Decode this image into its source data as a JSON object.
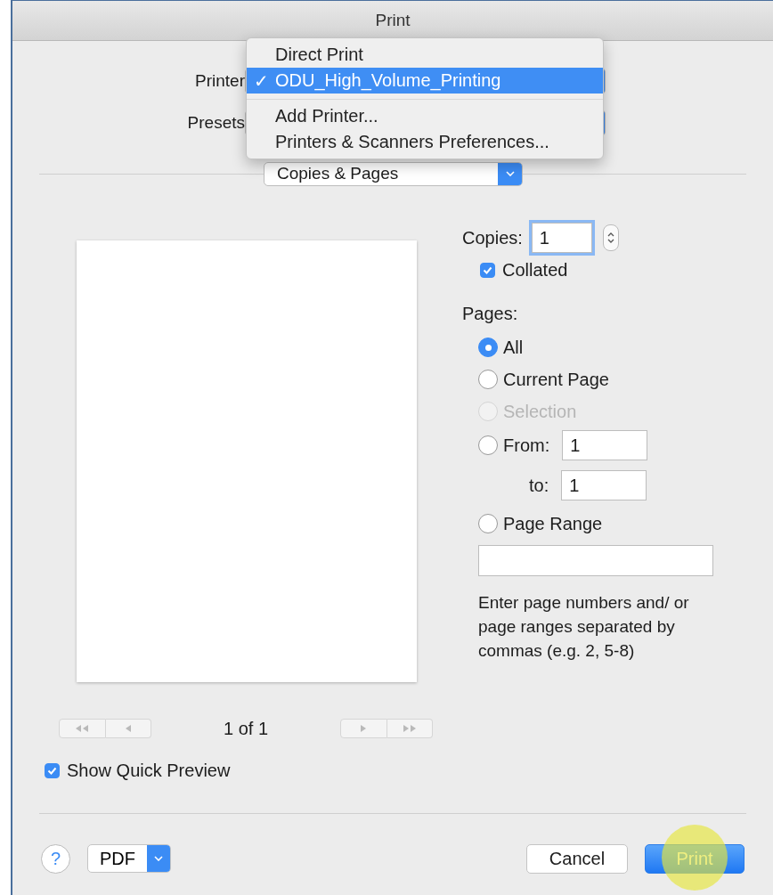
{
  "window": {
    "title": "Print"
  },
  "printer": {
    "label": "Printer"
  },
  "presets": {
    "label": "Presets"
  },
  "printer_menu": {
    "check_mark": "✓",
    "groups": [
      [
        {
          "label": "Direct Print",
          "selected": false
        },
        {
          "label": "ODU_High_Volume_Printing",
          "selected": true
        }
      ],
      [
        {
          "label": "Add Printer...",
          "selected": false
        },
        {
          "label": "Printers & Scanners Preferences...",
          "selected": false
        }
      ]
    ]
  },
  "section_popup": {
    "value": "Copies & Pages"
  },
  "copies": {
    "label": "Copies:",
    "value": "1"
  },
  "collated": {
    "label": "Collated",
    "checked": true
  },
  "pages": {
    "label": "Pages:",
    "options": [
      {
        "kind": "radio",
        "label": "All",
        "selected": true,
        "disabled": false
      },
      {
        "kind": "radio",
        "label": "Current Page",
        "selected": false,
        "disabled": false
      },
      {
        "kind": "radio",
        "label": "Selection",
        "selected": false,
        "disabled": true
      },
      {
        "kind": "from",
        "label": "From:",
        "value": "1",
        "to_label": "to:",
        "to_value": "1",
        "selected": false,
        "disabled": false
      },
      {
        "kind": "range",
        "label": "Page Range",
        "selected": false,
        "disabled": false
      }
    ],
    "hint": "Enter page numbers and/ or page ranges separated by commas (e.g. 2, 5-8)"
  },
  "preview_nav": {
    "indicator": "1 of 1"
  },
  "quick_preview": {
    "label": "Show Quick Preview",
    "checked": true
  },
  "footer": {
    "help": "?",
    "pdf": "PDF",
    "cancel": "Cancel",
    "print": "Print"
  }
}
